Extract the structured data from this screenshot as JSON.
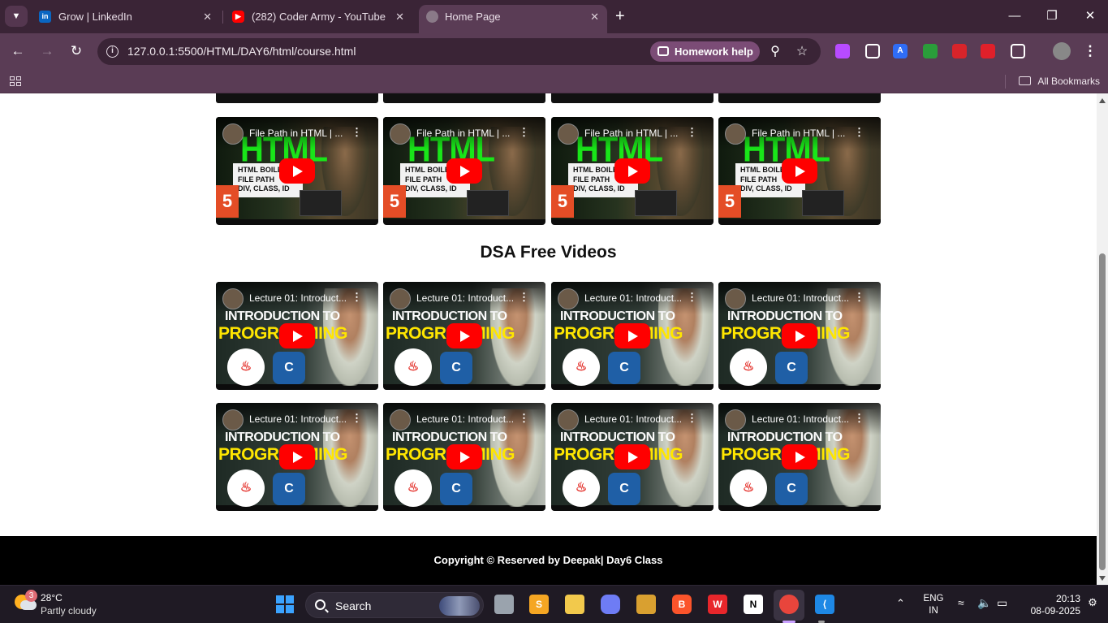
{
  "browser": {
    "tabs": [
      {
        "label": "Grow | LinkedIn",
        "icon": "linkedin-icon"
      },
      {
        "label": "(282) Coder Army - YouTube",
        "icon": "youtube-icon"
      },
      {
        "label": "Home Page",
        "icon": "globe-icon"
      }
    ],
    "url": "127.0.0.1:5500/HTML/DAY6/html/course.html",
    "homework_help": "Homework help",
    "all_bookmarks": "All Bookmarks"
  },
  "page": {
    "html_video_title": "File Path in HTML | ...",
    "html_thumb": {
      "word": "HTML",
      "lines": [
        "HTML BOILE",
        "FILE PATH",
        "DIV, CLASS, ID"
      ],
      "badge": "5"
    },
    "dsa_heading": "DSA Free Videos",
    "dsa_video_title": "Lecture 01: Introduct...",
    "dsa_thumb": {
      "line1": "INTRODUCTION TO",
      "line2": "PROGRAMMING"
    },
    "footer": "Copyright © Reserved by Deepak| Day6 Class"
  },
  "taskbar": {
    "weather_badge": "3",
    "temperature": "28°C",
    "weather": "Partly cloudy",
    "search": "Search",
    "lang_line1": "ENG",
    "lang_line2": "IN",
    "time": "20:13",
    "date": "08-09-2025"
  }
}
